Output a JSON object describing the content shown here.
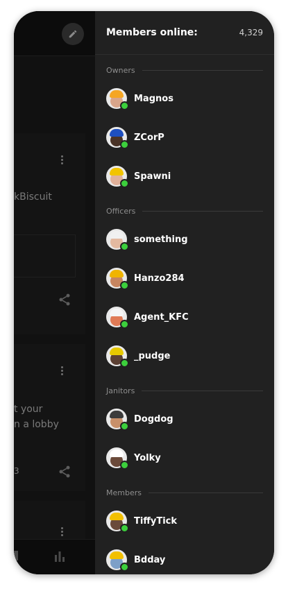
{
  "background_app": {
    "snippet_1": "kBiscuit",
    "snippet_2": "t your",
    "snippet_3": "n a lobby",
    "snippet_4": "3"
  },
  "drawer": {
    "title": "Members online:",
    "count": "4,329"
  },
  "sections": [
    {
      "label": "Owners",
      "members": [
        {
          "name": "Magnos",
          "helmet": "#f5a623",
          "skin": "#d9a58a"
        },
        {
          "name": "ZCorP",
          "helmet": "#1e4fbf",
          "skin": "#4a3326"
        },
        {
          "name": "Spawni",
          "helmet": "#f2c400",
          "skin": "#e1b19a"
        }
      ]
    },
    {
      "label": "Officers",
      "members": [
        {
          "name": "something",
          "helmet": "#f0f0f0",
          "skin": "#e3b9a0"
        },
        {
          "name": "Hanzo284",
          "helmet": "#f0b400",
          "skin": "#c7855f"
        },
        {
          "name": "Agent_KFC",
          "helmet": "#f5f5f5",
          "skin": "#e07a55"
        },
        {
          "name": "_pudge",
          "helmet": "#e6c800",
          "skin": "#5b4033"
        }
      ]
    },
    {
      "label": "Janitors",
      "members": [
        {
          "name": "Dogdog",
          "helmet": "#3b3b3b",
          "skin": "#c8906a"
        },
        {
          "name": "Yolky",
          "helmet": "#ffffff",
          "skin": "#6b4a3a"
        }
      ]
    },
    {
      "label": "Members",
      "members": [
        {
          "name": "TiffyTick",
          "helmet": "#f2c000",
          "skin": "#6a4a3a"
        },
        {
          "name": "Bdday",
          "helmet": "#f2c000",
          "skin": "#7da0c8"
        }
      ]
    }
  ],
  "colors": {
    "online": "#3ccf3c",
    "drawer_bg": "#212121"
  }
}
